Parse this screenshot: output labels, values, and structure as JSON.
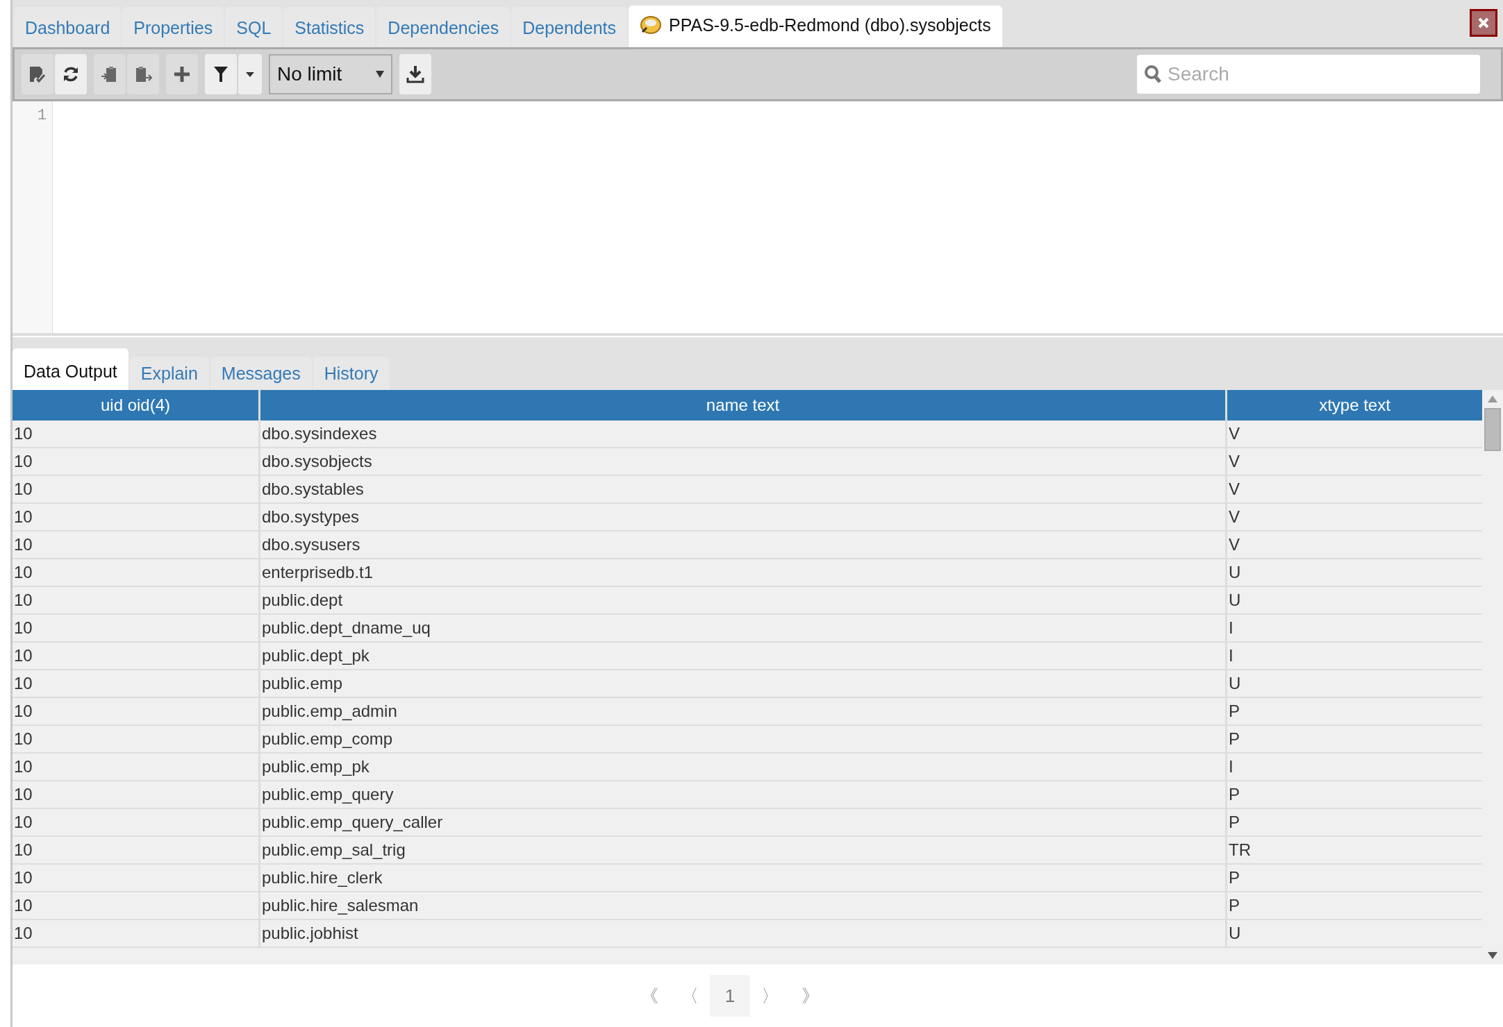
{
  "tabs": [
    {
      "label": "Dashboard",
      "selected": false
    },
    {
      "label": "Properties",
      "selected": false
    },
    {
      "label": "SQL",
      "selected": false
    },
    {
      "label": "Statistics",
      "selected": false
    },
    {
      "label": "Dependencies",
      "selected": false
    },
    {
      "label": "Dependents",
      "selected": false
    },
    {
      "label": "PPAS-9.5-edb-Redmond (dbo).sysobjects",
      "selected": true,
      "kind": "query"
    }
  ],
  "toolbar": {
    "limit": "No limit",
    "search": {
      "placeholder": "Search"
    }
  },
  "editor": {
    "line_numbers": [
      "1"
    ]
  },
  "result_tabs": [
    {
      "label": "Data Output",
      "selected": true
    },
    {
      "label": "Explain",
      "selected": false
    },
    {
      "label": "Messages",
      "selected": false
    },
    {
      "label": "History",
      "selected": false
    }
  ],
  "table": {
    "columns": [
      "uid oid(4)",
      "name text",
      "xtype text"
    ],
    "rows": [
      [
        "10",
        "dbo.sysindexes",
        "V"
      ],
      [
        "10",
        "dbo.sysobjects",
        "V"
      ],
      [
        "10",
        "dbo.systables",
        "V"
      ],
      [
        "10",
        "dbo.systypes",
        "V"
      ],
      [
        "10",
        "dbo.sysusers",
        "V"
      ],
      [
        "10",
        "enterprisedb.t1",
        "U"
      ],
      [
        "10",
        "public.dept",
        "U"
      ],
      [
        "10",
        "public.dept_dname_uq",
        "I"
      ],
      [
        "10",
        "public.dept_pk",
        "I"
      ],
      [
        "10",
        "public.emp",
        "U"
      ],
      [
        "10",
        "public.emp_admin",
        "P"
      ],
      [
        "10",
        "public.emp_comp",
        "P"
      ],
      [
        "10",
        "public.emp_pk",
        "I"
      ],
      [
        "10",
        "public.emp_query",
        "P"
      ],
      [
        "10",
        "public.emp_query_caller",
        "P"
      ],
      [
        "10",
        "public.emp_sal_trig",
        "TR"
      ],
      [
        "10",
        "public.hire_clerk",
        "P"
      ],
      [
        "10",
        "public.hire_salesman",
        "P"
      ],
      [
        "10",
        "public.jobhist",
        "U"
      ]
    ]
  },
  "pagination": {
    "first": "《",
    "prev": "〈",
    "page": "1",
    "next": "〉",
    "last": "》"
  }
}
